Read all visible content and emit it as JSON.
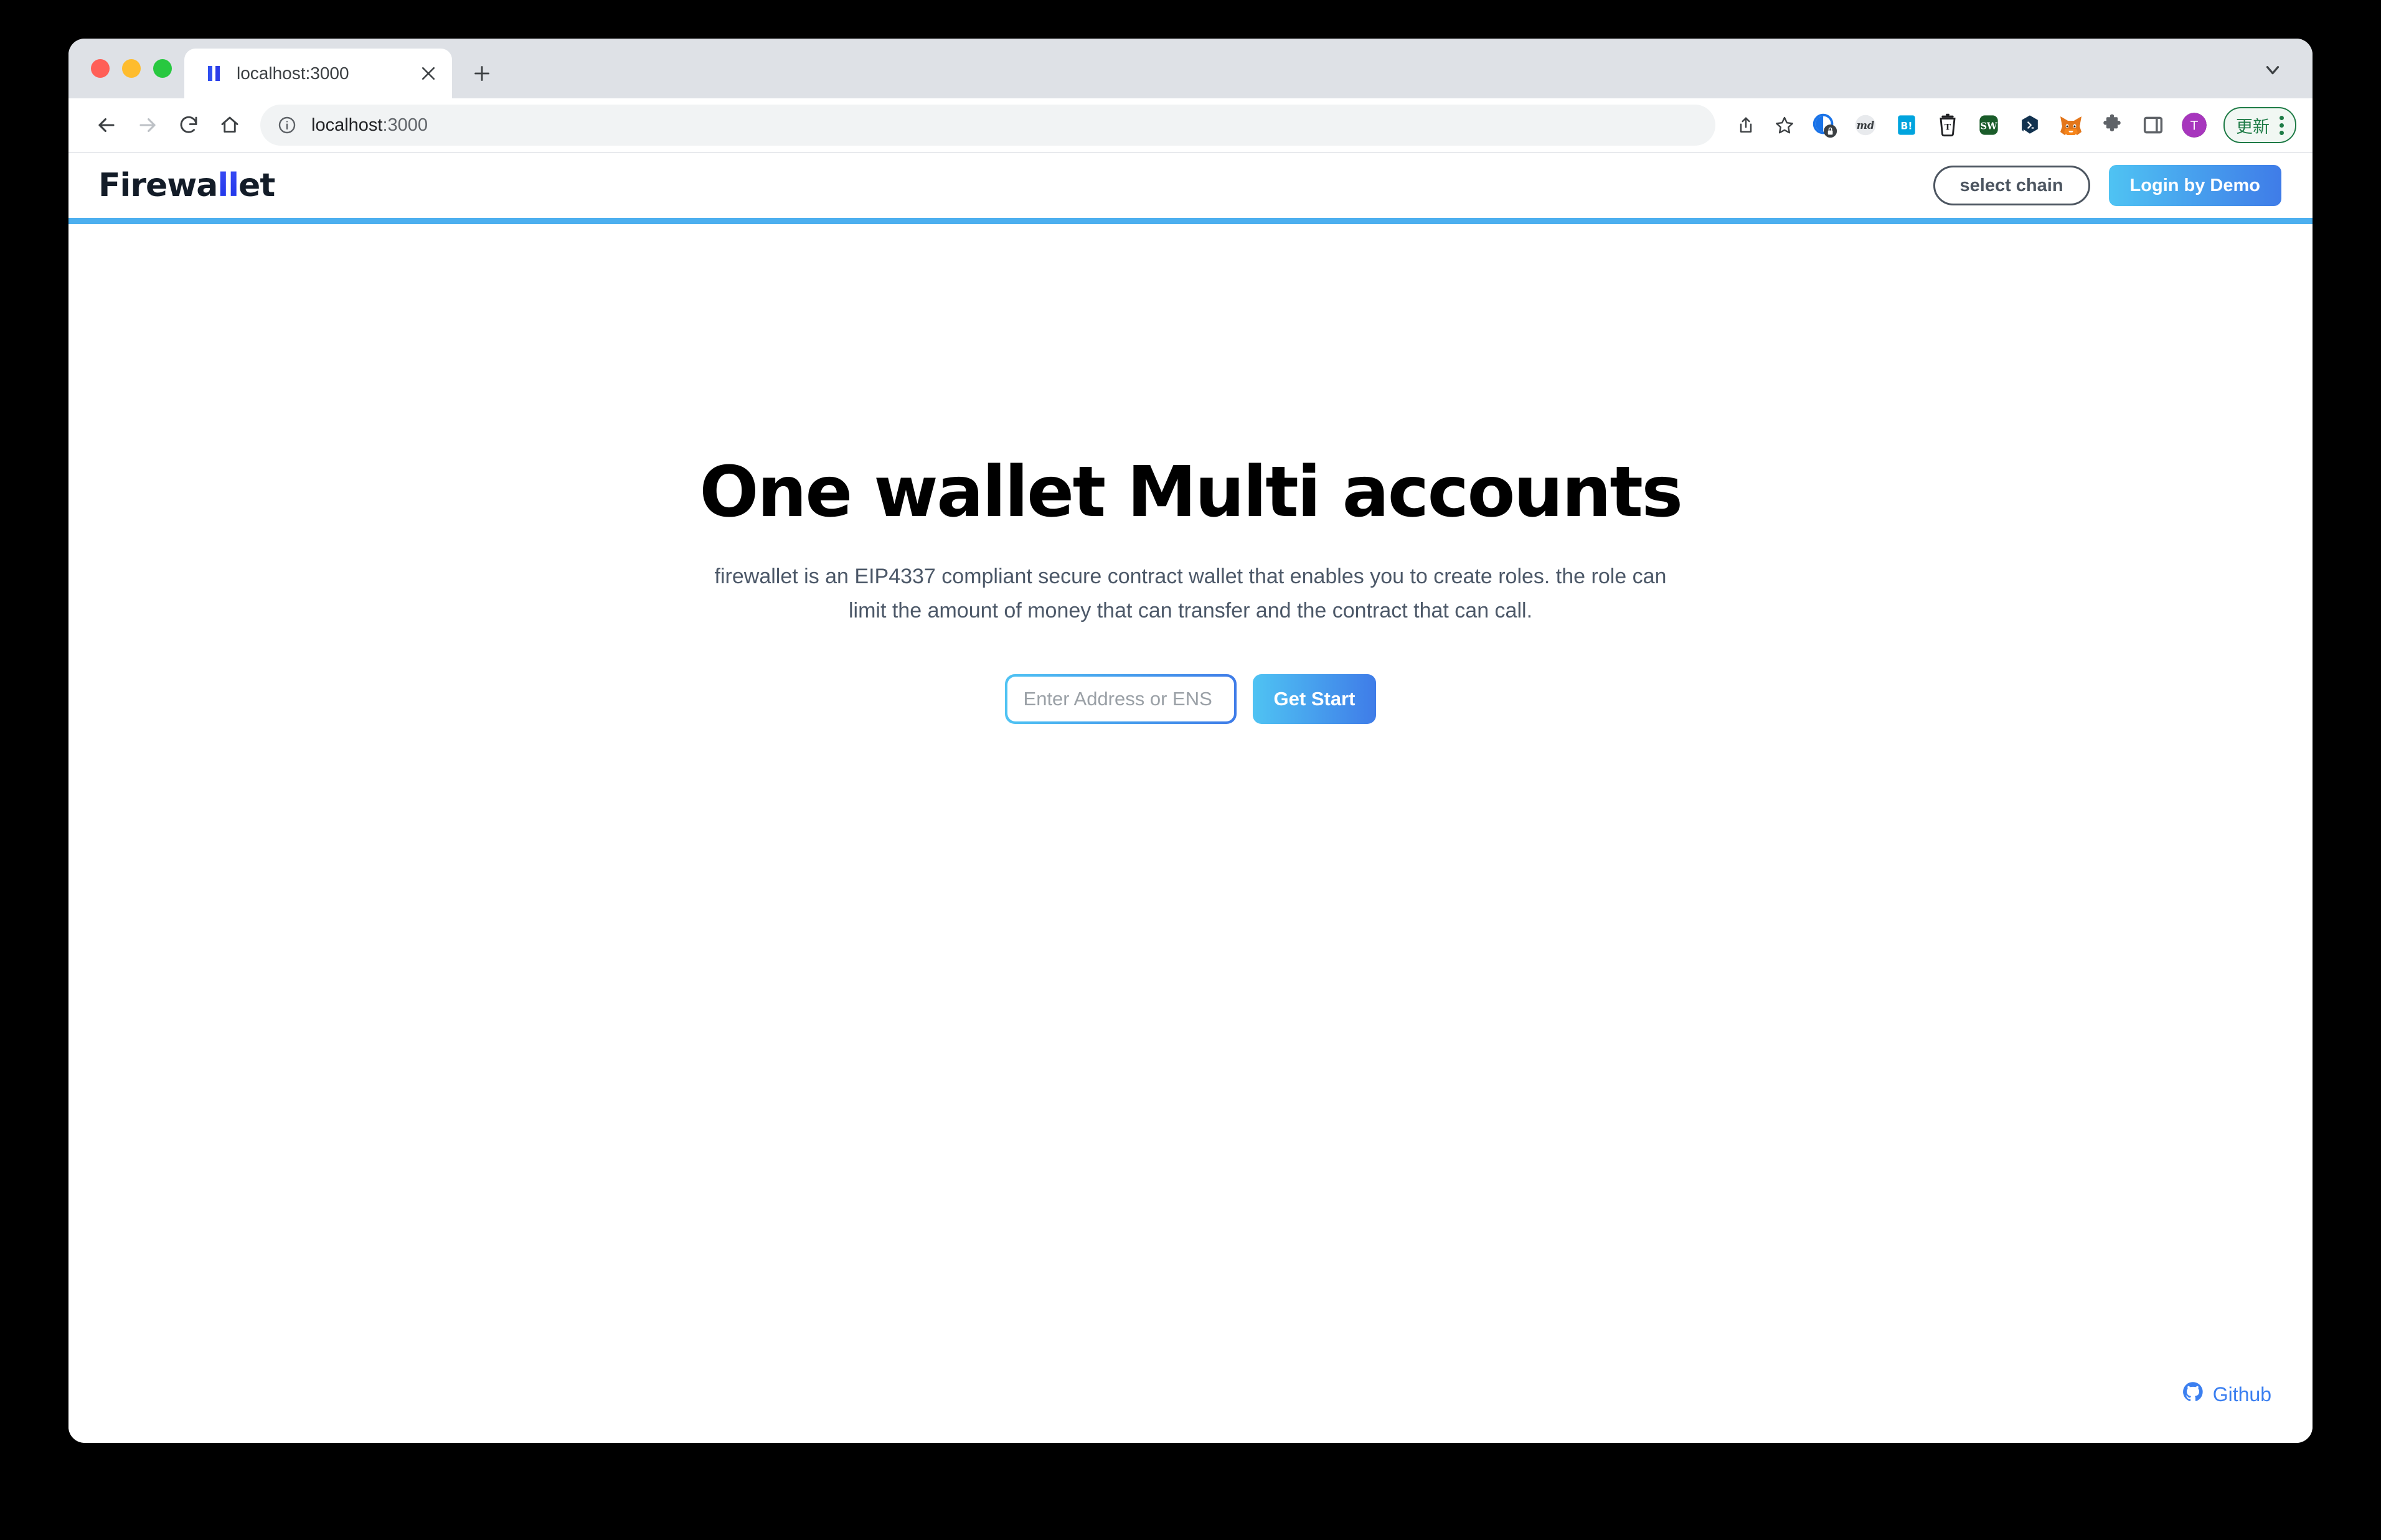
{
  "browser": {
    "traffic_lights": [
      "close",
      "minimize",
      "maximize"
    ],
    "tab": {
      "title": "localhost:3000",
      "favicon": "firewallet-bars-icon",
      "close_icon": "close-icon"
    },
    "new_tab_icon": "plus-icon",
    "tab_search_icon": "chevron-down-icon",
    "nav": {
      "back_icon": "arrow-left-icon",
      "forward_icon": "arrow-right-icon",
      "reload_icon": "reload-icon",
      "home_icon": "home-icon"
    },
    "omnibox": {
      "info_icon": "info-circle-icon",
      "host": "localhost",
      "port": ":3000"
    },
    "actions": {
      "share_icon": "share-icon",
      "bookmark_icon": "star-icon"
    },
    "extensions": [
      {
        "name": "privacy-lock-extension-icon",
        "label": ""
      },
      {
        "name": "markdown-extension-icon",
        "label": "md"
      },
      {
        "name": "hatena-bookmark-extension-icon",
        "label": "B!"
      },
      {
        "name": "tab-trash-extension-icon",
        "label": "T"
      },
      {
        "name": "steam-workshop-extension-icon",
        "label": "SW"
      },
      {
        "name": "chat-bubble-extension-icon",
        "label": ""
      },
      {
        "name": "metamask-extension-icon",
        "label": ""
      },
      {
        "name": "extensions-puzzle-icon",
        "label": ""
      },
      {
        "name": "side-panel-icon",
        "label": ""
      }
    ],
    "profile_avatar": "T",
    "update_button": {
      "label": "更新",
      "menu_icon": "kebab-menu-icon"
    }
  },
  "app": {
    "logo": {
      "prefix": "Firewa",
      "accent": "ll",
      "suffix": "et"
    },
    "header": {
      "select_chain_label": "select chain",
      "login_label": "Login by Demo"
    },
    "hero": {
      "title": "One wallet Multi accounts",
      "subtitle": "firewallet is an EIP4337 compliant secure contract wallet that enables you to create roles. the role can limit the amount of money that can transfer and the contract that can call.",
      "input_placeholder": "Enter Address or ENS",
      "input_value": "",
      "cta_label": "Get Start"
    },
    "footer": {
      "github_label": "Github",
      "github_icon": "github-icon"
    },
    "colors": {
      "accent_cyan": "#4fc3f3",
      "accent_blue": "#3f7ce8",
      "header_bar": "#4cafef",
      "logo_dark": "#131c28",
      "link_blue": "#3b7ff0"
    }
  }
}
